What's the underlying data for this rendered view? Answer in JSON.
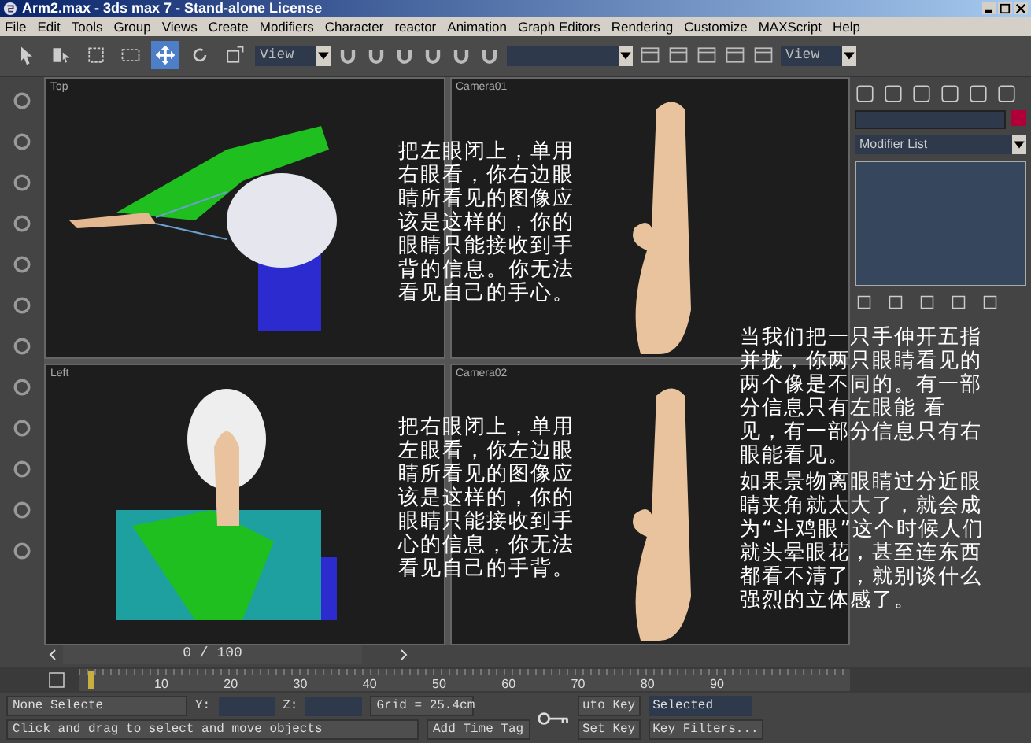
{
  "window": {
    "title": "Arm2.max - 3ds max 7 - Stand-alone License"
  },
  "menu": [
    "File",
    "Edit",
    "Tools",
    "Group",
    "Views",
    "Create",
    "Modifiers",
    "Character",
    "reactor",
    "Animation",
    "Graph Editors",
    "Rendering",
    "Customize",
    "MAXScript",
    "Help"
  ],
  "toolbar": {
    "buttons": [
      {
        "selected": false
      },
      {
        "selected": false
      },
      {
        "selected": false
      },
      {
        "selected": false
      },
      {
        "selected": true
      },
      {
        "selected": false
      },
      {
        "selected": false
      }
    ],
    "coord_dropdown": "View",
    "render_dropdown": "View"
  },
  "viewports": [
    {
      "label": "Top",
      "kind": "arm",
      "annotation": "把左眼闭上，单用右眼看，你右边眼睛所看见的图像应该是这样的，你的眼睛只能接收到手背的信息。你无法看见自己的手心。"
    },
    {
      "label": "Camera01",
      "kind": "hand",
      "annotation": "当我们把一只手伸开五指并拢，你两只眼睛看见的两个像是不同的。有一部分信息只有左眼能 看见，有一部分信息只有右眼能看见。"
    },
    {
      "label": "Left",
      "kind": "skeleton",
      "annotation": "把右眼闭上，单用左眼看，你左边眼睛所看见的图像应该是这样的，你的眼睛只能接收到手心的信息，你无法看见自己的手背。"
    },
    {
      "label": "Camera02",
      "kind": "hand",
      "annotation": "如果景物离眼睛过分近眼睛夹角就太大了，就会成为“斗鸡眼”这个时候人们就头晕眼花，甚至连东西都看不清了，就别谈什么强烈的立体感了。"
    }
  ],
  "command_panel": {
    "modifier_list": "Modifier List"
  },
  "timeline": {
    "position": "0 / 100",
    "level": 0.0,
    "ticks": [
      "10",
      "20",
      "30",
      "40",
      "50",
      "60",
      "70",
      "80",
      "90"
    ]
  },
  "status_bar": {
    "selection": "None Selecte",
    "y_label": "Y:",
    "z_label": "Z:",
    "grid": "Grid = 25.4cm",
    "prompt": "Click and drag to select and move objects",
    "add_time_tag": "Add Time Tag",
    "auto_key": "uto Key",
    "key_mode": "Selected",
    "set_key": "Set Key",
    "key_filters": "Key Filters..."
  }
}
